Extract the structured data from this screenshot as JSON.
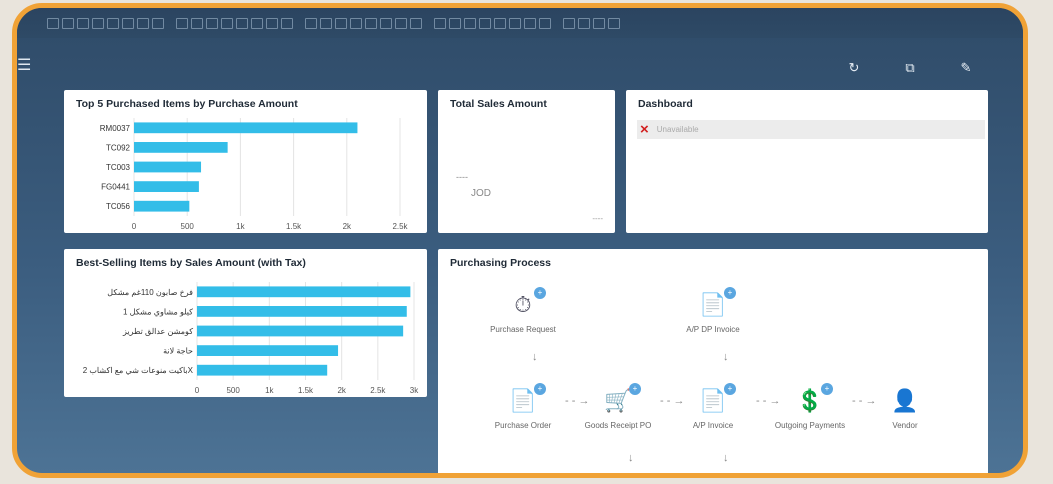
{
  "toolbar": {
    "icon_count": 40
  },
  "top_actions": [
    {
      "name": "refresh-icon",
      "glyph": "↻"
    },
    {
      "name": "export-icon",
      "glyph": "⧉"
    },
    {
      "name": "edit-icon",
      "glyph": "✎"
    }
  ],
  "cards": {
    "top5": {
      "title": "Top 5 Purchased Items by Purchase Amount"
    },
    "total_sales": {
      "title": "Total Sales Amount",
      "value": "----",
      "currency": "JOD",
      "footer": "----"
    },
    "dashboard": {
      "title": "Dashboard",
      "item_label": "Unavailable",
      "status_icon": "×"
    },
    "best_selling": {
      "title": "Best-Selling Items by Sales Amount (with Tax)"
    },
    "process": {
      "title": "Purchasing Process",
      "nodes": [
        {
          "id": "purchase-request",
          "label": "Purchase Request",
          "glyph": "⏱"
        },
        {
          "id": "ap-dp-invoice",
          "label": "A/P DP Invoice",
          "glyph": "📄"
        },
        {
          "id": "purchase-order",
          "label": "Purchase Order",
          "glyph": "📄"
        },
        {
          "id": "goods-receipt-po",
          "label": "Goods Receipt PO",
          "glyph": "🛒"
        },
        {
          "id": "ap-invoice",
          "label": "A/P Invoice",
          "glyph": "📄"
        },
        {
          "id": "outgoing-payments",
          "label": "Outgoing Payments",
          "glyph": "💲"
        },
        {
          "id": "vendor",
          "label": "Vendor",
          "glyph": "👤"
        }
      ],
      "badge": "+"
    }
  },
  "chart_data": [
    {
      "type": "bar",
      "title": "Top 5 Purchased Items by Purchase Amount",
      "categories": [
        "RM0037",
        "TC092",
        "TC003",
        "FG0441",
        "TC056"
      ],
      "values": [
        2100,
        880,
        630,
        610,
        520
      ],
      "xlim": [
        0,
        2500
      ],
      "xticks": [
        "0",
        "500",
        "1k",
        "1.5k",
        "2k",
        "2.5k"
      ],
      "orientation": "horizontal",
      "color": "#33bde8",
      "grid": true
    },
    {
      "type": "bar",
      "title": "Best-Selling Items by Sales Amount (with Tax)",
      "categories": [
        "فرخ صابون 110غم مشكل",
        "كيلو مشاوي مشكل 1",
        "كومشن عدالق تطريز",
        "حاجة لانة",
        "باكيت منوعات شي مع اكشاب 2X"
      ],
      "values": [
        2950,
        2900,
        2850,
        1950,
        1800
      ],
      "xlim": [
        0,
        3000
      ],
      "xticks": [
        "0",
        "500",
        "1k",
        "1.5k",
        "2k",
        "2.5k",
        "3k"
      ],
      "orientation": "horizontal",
      "color": "#33bde8",
      "grid": true
    }
  ]
}
